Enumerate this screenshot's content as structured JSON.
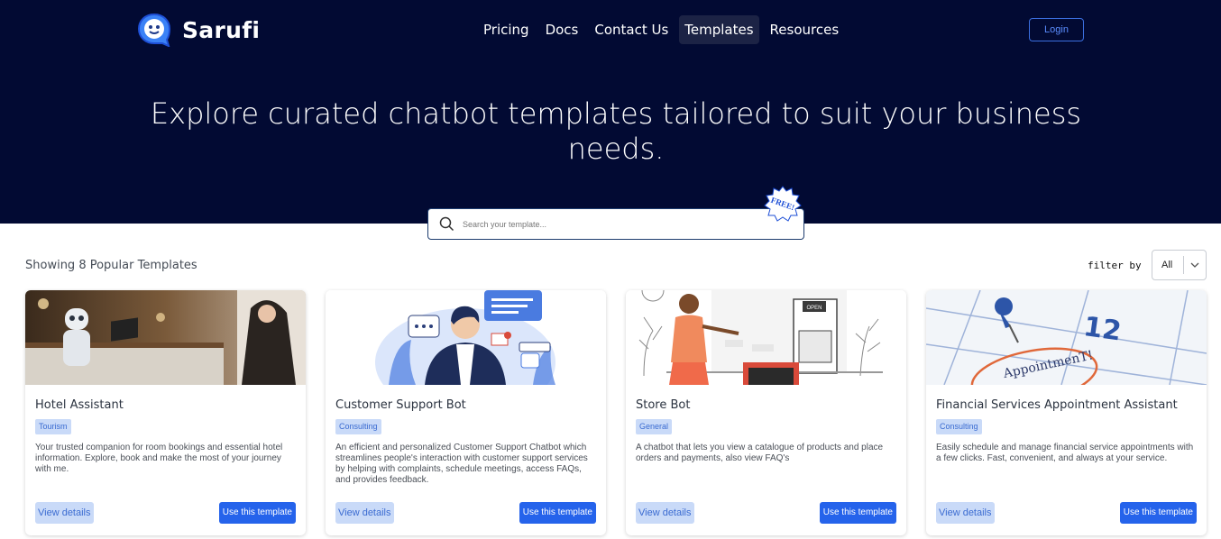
{
  "header": {
    "brand": "Sarufi",
    "nav": [
      "Pricing",
      "Docs",
      "Contact Us",
      "Templates",
      "Resources"
    ],
    "active_nav": "Templates",
    "login_label": "Login"
  },
  "hero": {
    "headline": "Explore curated chatbot templates tailored to suit your business needs."
  },
  "search": {
    "placeholder": "Search your template...",
    "badge": "FREE!"
  },
  "listing": {
    "showing_text": "Showing 8 Popular Templates",
    "filter_label": "filter by",
    "filter_value": "All"
  },
  "cards": [
    {
      "title": "Hotel Assistant",
      "tag": "Tourism",
      "description": "Your trusted companion for room bookings and essential hotel information. Explore, book and make the most of your journey with me.",
      "details_label": "View details",
      "use_label": "Use this template"
    },
    {
      "title": "Customer Support Bot",
      "tag": "Consulting",
      "description": "An efficient and personalized Customer Support Chatbot which streamlines people's interaction with customer support services by helping with complaints, schedule meetings, access FAQs, and provides feedback.",
      "details_label": "View details",
      "use_label": "Use this template"
    },
    {
      "title": "Store Bot",
      "tag": "General",
      "description": "A chatbot that lets you view a catalogue of products and place orders and payments, also view FAQ's",
      "details_label": "View details",
      "use_label": "Use this template",
      "image_sign": "OPEN"
    },
    {
      "title": "Financial Services Appointment Assistant",
      "tag": "Consulting",
      "description": "Easily schedule and manage financial service appointments with a few clicks. Fast, convenient, and always at your service.",
      "details_label": "View details",
      "use_label": "Use this template",
      "image_calendar_number": "12",
      "image_calendar_word": "AppointmenT!"
    }
  ],
  "colors": {
    "hero_bg": "#020a33",
    "primary": "#2563eb",
    "tag_bg": "#c9daf8"
  }
}
